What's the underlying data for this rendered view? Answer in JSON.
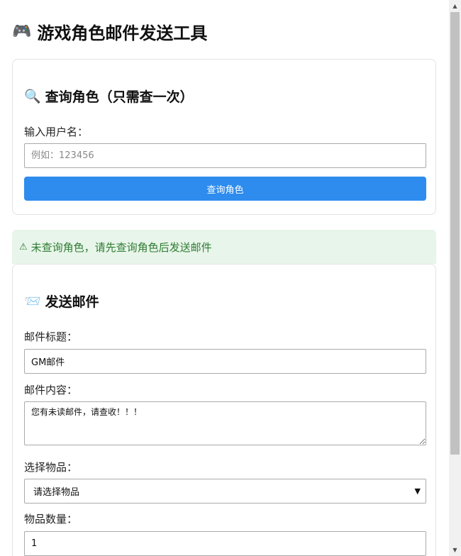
{
  "page": {
    "title": "游戏角色邮件发送工具",
    "title_icon": "🎮"
  },
  "query_card": {
    "heading": "查询角色（只需查一次）",
    "heading_icon": "🔍",
    "username_label": "输入用户名：",
    "username_placeholder": "例如：123456",
    "username_value": "",
    "query_button": "查询角色"
  },
  "alert": {
    "icon": "⚠",
    "text": "未查询角色，请先查询角色后发送邮件"
  },
  "mail_card": {
    "heading": "发送邮件",
    "heading_icon": "📨",
    "subject_label": "邮件标题：",
    "subject_value": "GM邮件",
    "body_label": "邮件内容：",
    "body_value": "您有未读邮件，请查收！！！",
    "item_label": "选择物品：",
    "item_selected": "请选择物品",
    "quantity_label": "物品数量：",
    "quantity_value": "1"
  },
  "colors": {
    "primary_button": "#2e8cee",
    "alert_background": "#e8f5ea",
    "alert_text": "#2e7d32"
  }
}
